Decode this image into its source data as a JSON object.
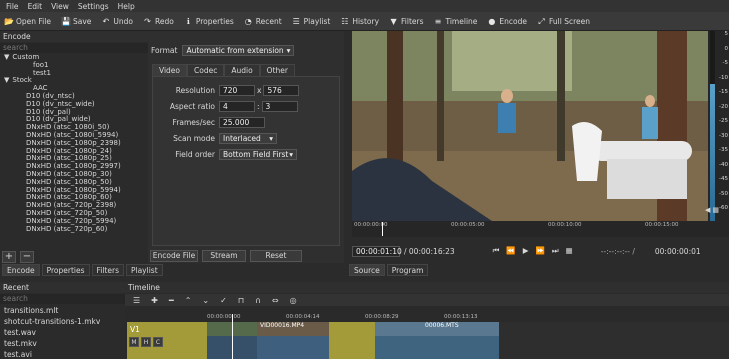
{
  "menu": [
    "File",
    "Edit",
    "View",
    "Settings",
    "Help"
  ],
  "toolbar": [
    {
      "icon": "open-file-icon",
      "glyph": "📂",
      "label": "Open File"
    },
    {
      "icon": "save-icon",
      "glyph": "💾",
      "label": "Save"
    },
    {
      "icon": "undo-icon",
      "glyph": "↶",
      "label": "Undo"
    },
    {
      "icon": "redo-icon",
      "glyph": "↷",
      "label": "Redo"
    },
    {
      "icon": "info-icon",
      "glyph": "ℹ",
      "label": "Properties"
    },
    {
      "icon": "recent-icon",
      "glyph": "◔",
      "label": "Recent"
    },
    {
      "icon": "playlist-icon",
      "glyph": "☰",
      "label": "Playlist"
    },
    {
      "icon": "history-icon",
      "glyph": "☷",
      "label": "History"
    },
    {
      "icon": "filters-icon",
      "glyph": "▼",
      "label": "Filters"
    },
    {
      "icon": "timeline-icon",
      "glyph": "≡",
      "label": "Timeline"
    },
    {
      "icon": "encode-icon",
      "glyph": "●",
      "label": "Encode"
    },
    {
      "icon": "fullscreen-icon",
      "glyph": "⤢",
      "label": "Full Screen"
    }
  ],
  "encode": {
    "title": "Encode",
    "search_placeholder": "search",
    "presets": [
      {
        "text": "Custom",
        "level": 0,
        "arrow": "▼"
      },
      {
        "text": "foo1",
        "level": 2
      },
      {
        "text": "test1",
        "level": 2
      },
      {
        "text": "Stock",
        "level": 0,
        "arrow": "▼"
      },
      {
        "text": "AAC",
        "level": 2
      },
      {
        "text": "D10 (dv_ntsc)",
        "level": 1
      },
      {
        "text": "D10 (dv_ntsc_wide)",
        "level": 1
      },
      {
        "text": "D10 (dv_pal)",
        "level": 1
      },
      {
        "text": "D10 (dv_pal_wide)",
        "level": 1
      },
      {
        "text": "DNxHD (atsc_1080i_50)",
        "level": 1
      },
      {
        "text": "DNxHD (atsc_1080i_5994)",
        "level": 1
      },
      {
        "text": "DNxHD (atsc_1080p_2398)",
        "level": 1
      },
      {
        "text": "DNxHD (atsc_1080p_24)",
        "level": 1
      },
      {
        "text": "DNxHD (atsc_1080p_25)",
        "level": 1
      },
      {
        "text": "DNxHD (atsc_1080p_2997)",
        "level": 1
      },
      {
        "text": "DNxHD (atsc_1080p_30)",
        "level": 1
      },
      {
        "text": "DNxHD (atsc_1080p_50)",
        "level": 1
      },
      {
        "text": "DNxHD (atsc_1080p_5994)",
        "level": 1
      },
      {
        "text": "DNxHD (atsc_1080p_60)",
        "level": 1
      },
      {
        "text": "DNxHD (atsc_720p_2398)",
        "level": 1
      },
      {
        "text": "DNxHD (atsc_720p_50)",
        "level": 1
      },
      {
        "text": "DNxHD (atsc_720p_5994)",
        "level": 1
      },
      {
        "text": "DNxHD (atsc_720p_60)",
        "level": 1
      }
    ],
    "add_glyph": "+",
    "remove_glyph": "−",
    "format_label": "Format",
    "format_value": "Automatic from extension",
    "tabs": [
      "Video",
      "Codec",
      "Audio",
      "Other"
    ],
    "resolution_label": "Resolution",
    "res_w": "720",
    "res_x": "x",
    "res_h": "576",
    "aspect_label": "Aspect ratio",
    "aspect_a": "4",
    "aspect_sep": ":",
    "aspect_b": "3",
    "fps_label": "Frames/sec",
    "fps": "25.000",
    "scan_label": "Scan mode",
    "scan": "Interlaced",
    "field_label": "Field order",
    "field": "Bottom Field First",
    "encode_btn": "Encode File",
    "stream_btn": "Stream",
    "reset_btn": "Reset"
  },
  "left_tabs": [
    "Encode",
    "Properties",
    "Filters",
    "Playlist"
  ],
  "recent": {
    "title": "Recent",
    "search_placeholder": "search",
    "items": [
      "transitions.mlt",
      "shotcut-transitions-1.mkv",
      "test.wav",
      "test.mkv",
      "test.avi"
    ]
  },
  "player": {
    "ruler": [
      "00:00:00:00",
      "00:00:05:00",
      "00:00:10:00",
      "00:00:15:00"
    ],
    "position": "00:00:01:10",
    "duration": "/ 00:00:16:23",
    "in_out": "--:--:--:-- /",
    "selected": "00:00:00:01",
    "tabs": [
      "Source",
      "Program"
    ]
  },
  "meter": {
    "scale": [
      "5",
      "0",
      "-5",
      "-10",
      "-15",
      "-20",
      "-25",
      "-30",
      "-35",
      "-40",
      "-45",
      "-50",
      "-60"
    ],
    "level": 0.72
  },
  "timeline": {
    "title": "Timeline",
    "track": "V1",
    "track_buttons": [
      "M",
      "H",
      "C"
    ],
    "ruler": [
      "00:00:00:00",
      "00:00:04:14",
      "00:00:08:29",
      "00:00:13:13"
    ],
    "clip1": "VID00016.MP4",
    "clip2": "00006.MTS"
  }
}
